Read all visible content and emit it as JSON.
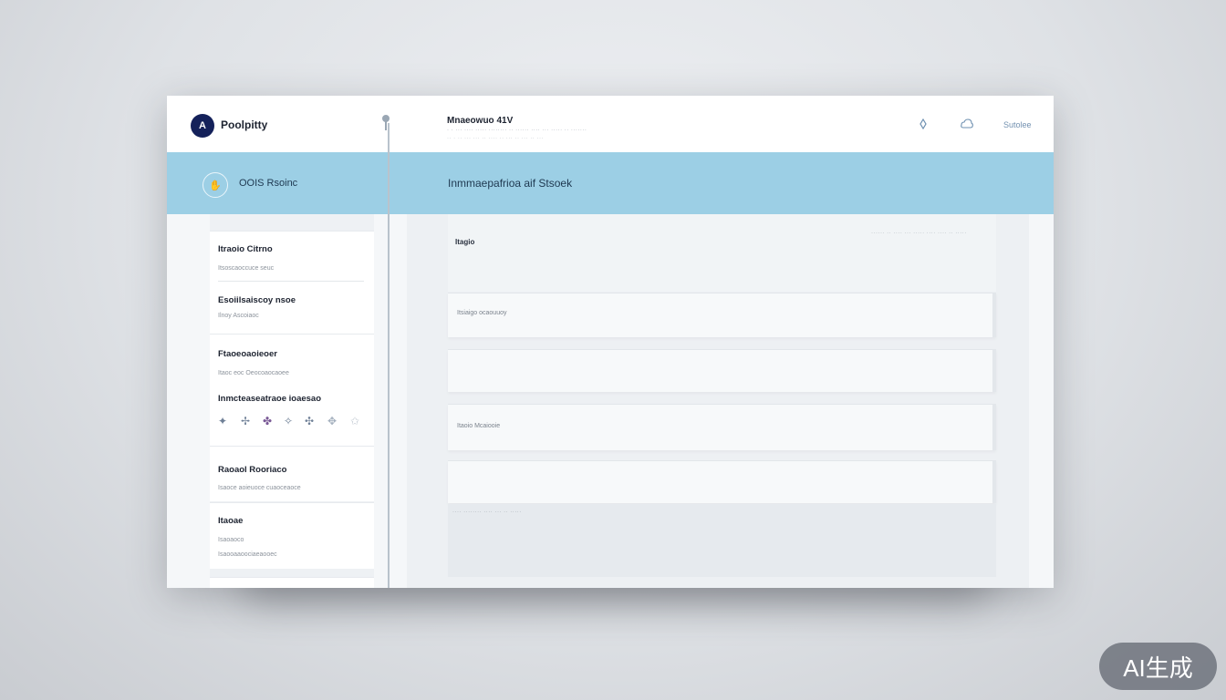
{
  "app": {
    "logo_letter": "A",
    "name": "Poolpitty"
  },
  "header": {
    "title": "Mnaeowuo 41V",
    "subtitle": "· · ··· ···· ····· ········ ·· ······ ···· ··· ····· ·· ·······",
    "subtitle2": "·· · ·· ··· ··· ·· ···· ·· ··· ·· ··· ·· ···",
    "link": "Sutolee",
    "icons": [
      "info-icon",
      "cloud-icon"
    ]
  },
  "banner": {
    "left_text": "OOIS Rsoinc",
    "title": "Inmmaepafrioa aif Stsoek"
  },
  "sidebar": {
    "cards": [
      {
        "title": "Itraoio Citrno",
        "sub": "Itsoscaoccuce seuc"
      },
      {
        "title": "Esoiilsaiscoy nsoe",
        "sub": "Ilnoy Ascoiaoc"
      },
      {
        "title": "Ftaoeoaoieoer",
        "sub": "Itaoc eoc Oeocoaocaoee",
        "title2": "Inmcteaseatraoe ioaesao",
        "tools": [
          "✦",
          "✢",
          "✤",
          "✧",
          "✣",
          "✥",
          "✩"
        ]
      },
      {
        "title": "Raoaol Rooriaco",
        "sub": "Isaoce aoieuoce cuaoceaoce"
      },
      {
        "title": "Itaoae",
        "sub": "Isaoaoco",
        "sub2": "Isaooaaoociaeaooec"
      }
    ]
  },
  "content": {
    "panel_label": "Itagio",
    "panel_right": "······ ·· ···· ··· ····· ···· ···· ·· ·····",
    "rows": [
      {
        "text": "Itsiaigo     ocaouuoy"
      },
      {
        "text": ""
      },
      {
        "text": "Itaoio     Mcaiooie"
      },
      {
        "text": ""
      }
    ],
    "footer_note": "···· ········ ···· ··· ·· ·····"
  },
  "badge": {
    "label": "AI生成"
  }
}
